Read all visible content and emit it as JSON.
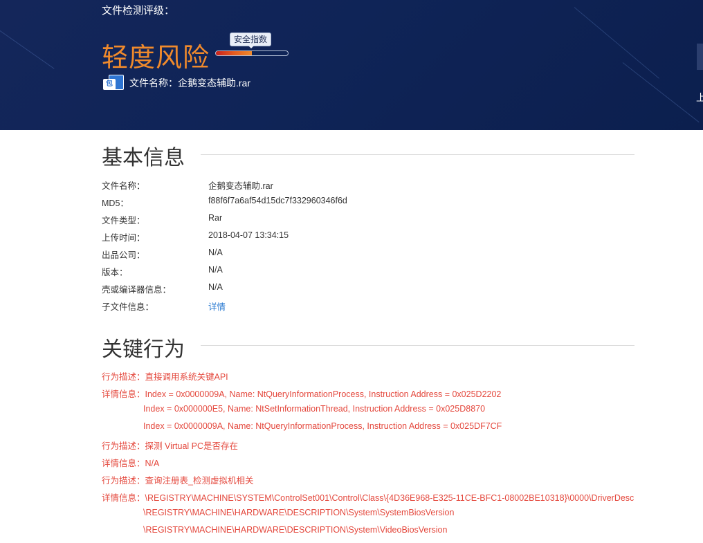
{
  "header": {
    "rating_label": "文件检测评级：",
    "risk_level": "轻度风险",
    "risk_color": "#f08a2c",
    "gauge": {
      "label": "安全指数",
      "level_fraction": 0.5
    },
    "file_icon_text": "包",
    "file_name_label": "文件名称：",
    "file_name": "企鹅变态辅助.rar",
    "right_edge_text": "上"
  },
  "basic_info": {
    "title": "基本信息",
    "rows": [
      {
        "key": "文件名称：",
        "value": "企鹅变态辅助.rar"
      },
      {
        "key": "MD5：",
        "value": "f88f6f7a6af54d15dc7f332960346f6d"
      },
      {
        "key": "文件类型：",
        "value": "Rar"
      },
      {
        "key": "上传时间：",
        "value": "2018-04-07 13:34:15"
      },
      {
        "key": "出品公司：",
        "value": "N/A"
      },
      {
        "key": "版本：",
        "value": "N/A"
      },
      {
        "key": "壳或编译器信息：",
        "value": "N/A"
      },
      {
        "key": "子文件信息：",
        "value": "详情"
      }
    ]
  },
  "key_behaviors": {
    "title": "关键行为",
    "color": "#e4483d",
    "lines": [
      "行为描述：直接调用系统关键API",
      "详情信息：Index = 0x0000009A, Name: NtQueryInformationProcess, Instruction Address = 0x025D2202",
      "Index = 0x000000E5, Name: NtSetInformationThread, Instruction Address = 0x025D8870",
      "Index = 0x0000009A, Name: NtQueryInformationProcess, Instruction Address = 0x025DF7CF",
      "行为描述：探测 Virtual PC是否存在",
      "详情信息：N/A",
      "行为描述：查询注册表_检测虚拟机相关",
      "详情信息：\\REGISTRY\\MACHINE\\SYSTEM\\ControlSet001\\Control\\Class\\{4D36E968-E325-11CE-BFC1-08002BE10318}\\0000\\DriverDesc",
      "\\REGISTRY\\MACHINE\\HARDWARE\\DESCRIPTION\\System\\SystemBiosVersion",
      "\\REGISTRY\\MACHINE\\HARDWARE\\DESCRIPTION\\System\\VideoBiosVersion"
    ]
  }
}
